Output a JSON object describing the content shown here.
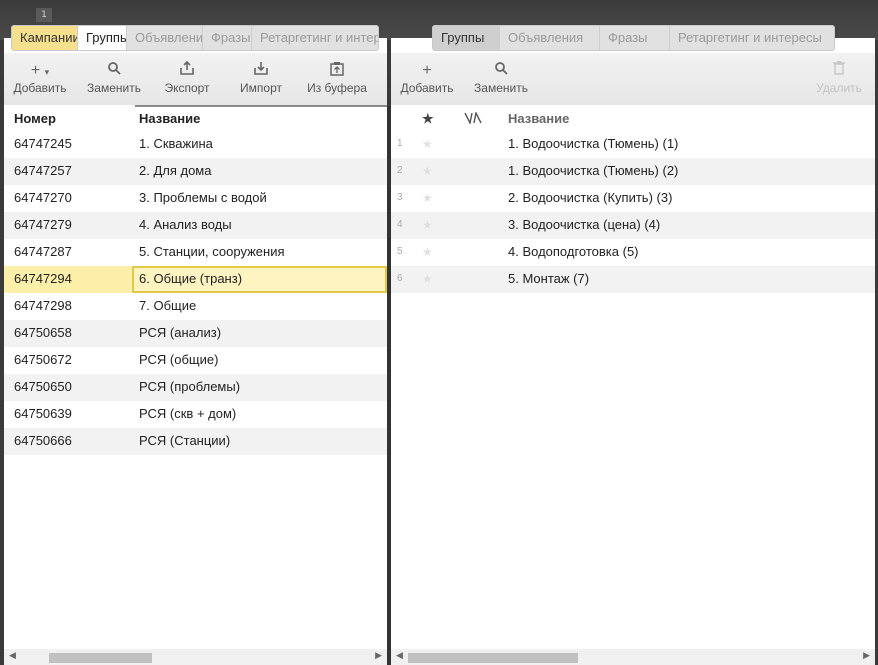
{
  "window_number": "1",
  "left": {
    "tabs": [
      {
        "label": "Кампании",
        "state": "yellow"
      },
      {
        "label": "Группы",
        "state": "white"
      },
      {
        "label": "Объявления",
        "state": "inactive"
      },
      {
        "label": "Фразы",
        "state": "inactive"
      },
      {
        "label": "Ретаргетинг и интересы",
        "state": "inactive"
      }
    ],
    "toolbar": {
      "add": "Добавить",
      "replace": "Заменить",
      "export": "Экспорт",
      "import": "Импорт",
      "from_buffer": "Из буфера"
    },
    "columns": {
      "number": "Номер",
      "name": "Название"
    },
    "rows": [
      {
        "number": "64747245",
        "name": "1. Скважина"
      },
      {
        "number": "64747257",
        "name": "2. Для дома"
      },
      {
        "number": "64747270",
        "name": "3. Проблемы с водой"
      },
      {
        "number": "64747279",
        "name": "4. Анализ воды"
      },
      {
        "number": "64747287",
        "name": "5. Станции, сооружения"
      },
      {
        "number": "64747294",
        "name": "6. Общие (транз)"
      },
      {
        "number": "64747298",
        "name": "7. Общие"
      },
      {
        "number": "64750658",
        "name": "РСЯ (анализ)"
      },
      {
        "number": "64750672",
        "name": "РСЯ (общие)"
      },
      {
        "number": "64750650",
        "name": "РСЯ (проблемы)"
      },
      {
        "number": "64750639",
        "name": "РСЯ (скв + дом)"
      },
      {
        "number": "64750666",
        "name": "РСЯ (Станции)"
      }
    ],
    "selected_row_index": 5
  },
  "right": {
    "tabs": [
      {
        "label": "Группы",
        "state": "active"
      },
      {
        "label": "Объявления",
        "state": "inactive"
      },
      {
        "label": "Фразы",
        "state": "inactive"
      },
      {
        "label": "Ретаргетинг и интересы",
        "state": "inactive"
      }
    ],
    "toolbar": {
      "add": "Добавить",
      "replace": "Заменить",
      "delete": "Удалить"
    },
    "columns": {
      "name": "Название"
    },
    "rows": [
      {
        "num": "1",
        "name": "1. Водоочистка (Тюмень) (1)"
      },
      {
        "num": "2",
        "name": "1. Водоочистка (Тюмень) (2)"
      },
      {
        "num": "3",
        "name": "2. Водоочистка (Купить) (3)"
      },
      {
        "num": "4",
        "name": "3. Водоочистка (цена) (4)"
      },
      {
        "num": "5",
        "name": "4. Водоподготовка (5)"
      },
      {
        "num": "6",
        "name": "5. Монтаж (7)"
      }
    ]
  },
  "icons": {
    "add": "plus-icon",
    "replace": "search-icon",
    "export": "upload-icon",
    "import": "download-icon",
    "from_buffer": "clipboard-icon",
    "delete": "trash-icon",
    "star": "star-icon",
    "sort": "sort-icon"
  }
}
